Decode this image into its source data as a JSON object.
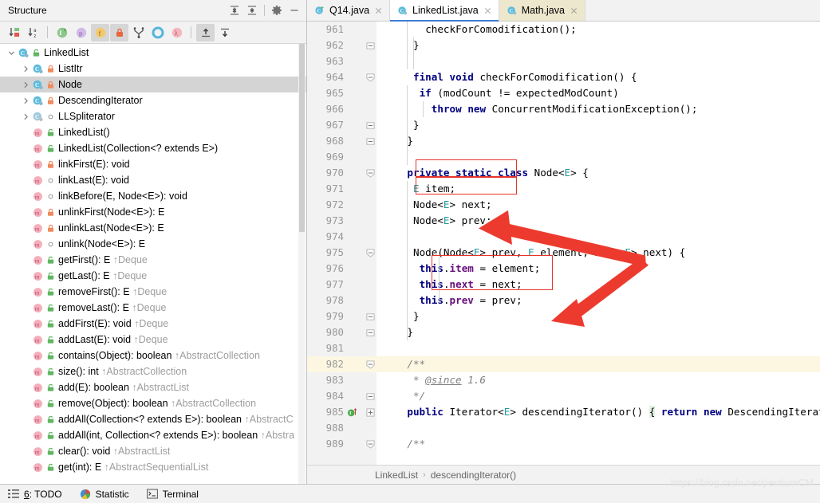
{
  "structure": {
    "title": "Structure",
    "header_buttons": [
      {
        "name": "expand-all-icon",
        "label": "Expand All"
      },
      {
        "name": "collapse-all-icon",
        "label": "Collapse All"
      },
      {
        "name": "gear-icon",
        "label": "Settings"
      },
      {
        "name": "hide-icon",
        "label": "Hide"
      }
    ],
    "toolbar_buttons": [
      {
        "name": "sort-by-visibility-icon",
        "label": "Sort by Visibility",
        "active": false
      },
      {
        "name": "sort-alphabetically-icon",
        "label": "Sort Alphabetically",
        "active": false
      },
      {
        "name": "show-inherited-icon",
        "label": "Show Inherited",
        "active": false
      },
      {
        "name": "show-properties-icon",
        "label": "Show Properties",
        "active": false
      },
      {
        "name": "show-fields-icon",
        "label": "Show Fields",
        "active": true
      },
      {
        "name": "show-non-public-icon",
        "label": "Show Non-Public",
        "active": true
      },
      {
        "name": "show-anonymous-classes-icon",
        "label": "Show Anonymous Classes",
        "active": false
      },
      {
        "name": "group-by-interface-icon",
        "label": "Group Methods by Defining Type",
        "active": false
      },
      {
        "name": "show-lambdas-icon",
        "label": "Show Lambdas",
        "active": false
      },
      {
        "name": "autoscroll-to-source-icon",
        "label": "Autoscroll to Source",
        "active": true
      },
      {
        "name": "autoscroll-from-source-icon",
        "label": "Autoscroll from Source",
        "active": false
      }
    ],
    "tree": [
      {
        "label": "LinkedList",
        "depth": 0,
        "twisty": "expanded",
        "icon": "class-icon",
        "vis": "protected-green",
        "selected": false
      },
      {
        "label": "ListItr",
        "depth": 1,
        "twisty": "collapsed",
        "icon": "class-icon",
        "vis": "private-orange",
        "selected": false
      },
      {
        "label": "Node",
        "depth": 1,
        "twisty": "collapsed",
        "icon": "class-icon",
        "vis": "private-orange",
        "selected": true
      },
      {
        "label": "DescendingIterator",
        "depth": 1,
        "twisty": "collapsed",
        "icon": "class-icon",
        "vis": "private-orange",
        "selected": false
      },
      {
        "label": "LLSpliterator",
        "depth": 1,
        "twisty": "collapsed",
        "icon": "class-excluded-icon",
        "vis": "package-local",
        "selected": false
      },
      {
        "label": "LinkedList()",
        "depth": 1,
        "twisty": "none",
        "icon": "method-icon",
        "vis": "protected-green",
        "selected": false
      },
      {
        "label": "LinkedList(Collection<? extends E>)",
        "depth": 1,
        "twisty": "none",
        "icon": "method-icon",
        "vis": "protected-green",
        "selected": false
      },
      {
        "label": "linkFirst(E): void",
        "depth": 1,
        "twisty": "none",
        "icon": "method-icon",
        "vis": "private-orange",
        "selected": false
      },
      {
        "label": "linkLast(E): void",
        "depth": 1,
        "twisty": "none",
        "icon": "method-icon",
        "vis": "package-local",
        "selected": false
      },
      {
        "label": "linkBefore(E, Node<E>): void",
        "depth": 1,
        "twisty": "none",
        "icon": "method-icon",
        "vis": "package-local",
        "selected": false
      },
      {
        "label": "unlinkFirst(Node<E>): E",
        "depth": 1,
        "twisty": "none",
        "icon": "method-icon",
        "vis": "private-orange",
        "selected": false
      },
      {
        "label": "unlinkLast(Node<E>): E",
        "depth": 1,
        "twisty": "none",
        "icon": "method-icon",
        "vis": "private-orange",
        "selected": false
      },
      {
        "label": "unlink(Node<E>): E",
        "depth": 1,
        "twisty": "none",
        "icon": "method-icon",
        "vis": "package-local",
        "selected": false
      },
      {
        "label": "getFirst(): E",
        "inherited": "↑Deque",
        "depth": 1,
        "twisty": "none",
        "icon": "method-icon",
        "vis": "protected-green",
        "selected": false
      },
      {
        "label": "getLast(): E",
        "inherited": "↑Deque",
        "depth": 1,
        "twisty": "none",
        "icon": "method-icon",
        "vis": "protected-green",
        "selected": false
      },
      {
        "label": "removeFirst(): E",
        "inherited": "↑Deque",
        "depth": 1,
        "twisty": "none",
        "icon": "method-icon",
        "vis": "protected-green",
        "selected": false
      },
      {
        "label": "removeLast(): E",
        "inherited": "↑Deque",
        "depth": 1,
        "twisty": "none",
        "icon": "method-icon",
        "vis": "protected-green",
        "selected": false
      },
      {
        "label": "addFirst(E): void",
        "inherited": "↑Deque",
        "depth": 1,
        "twisty": "none",
        "icon": "method-icon",
        "vis": "protected-green",
        "selected": false
      },
      {
        "label": "addLast(E): void",
        "inherited": "↑Deque",
        "depth": 1,
        "twisty": "none",
        "icon": "method-icon",
        "vis": "protected-green",
        "selected": false
      },
      {
        "label": "contains(Object): boolean",
        "inherited": "↑AbstractCollection",
        "depth": 1,
        "twisty": "none",
        "icon": "method-icon",
        "vis": "protected-green",
        "selected": false
      },
      {
        "label": "size(): int",
        "inherited": "↑AbstractCollection",
        "depth": 1,
        "twisty": "none",
        "icon": "method-icon",
        "vis": "protected-green",
        "selected": false
      },
      {
        "label": "add(E): boolean",
        "inherited": "↑AbstractList",
        "depth": 1,
        "twisty": "none",
        "icon": "method-icon",
        "vis": "protected-green",
        "selected": false
      },
      {
        "label": "remove(Object): boolean",
        "inherited": "↑AbstractCollection",
        "depth": 1,
        "twisty": "none",
        "icon": "method-icon",
        "vis": "protected-green",
        "selected": false
      },
      {
        "label": "addAll(Collection<? extends E>): boolean",
        "inherited": "↑AbstractC",
        "depth": 1,
        "twisty": "none",
        "icon": "method-icon",
        "vis": "protected-green",
        "selected": false
      },
      {
        "label": "addAll(int, Collection<? extends E>): boolean",
        "inherited": "↑Abstra",
        "depth": 1,
        "twisty": "none",
        "icon": "method-icon",
        "vis": "protected-green",
        "selected": false
      },
      {
        "label": "clear(): void",
        "inherited": "↑AbstractList",
        "depth": 1,
        "twisty": "none",
        "icon": "method-icon",
        "vis": "protected-green",
        "selected": false
      },
      {
        "label": "get(int): E",
        "inherited": "↑AbstractSequentialList",
        "depth": 1,
        "twisty": "none",
        "icon": "method-icon",
        "vis": "protected-green",
        "selected": false
      }
    ]
  },
  "editor": {
    "tabs": [
      {
        "label": "Q14.java",
        "icon": "java-run-icon",
        "state": "inactive"
      },
      {
        "label": "LinkedList.java",
        "icon": "java-readonly-icon",
        "state": "selected"
      },
      {
        "label": "Math.java",
        "icon": "java-readonly-icon",
        "state": "highlight"
      }
    ],
    "lines": [
      {
        "no": "961",
        "fold": "",
        "gicon": "",
        "indent": 7,
        "tokens": [
          [
            "dflt",
            "checkForComodification();"
          ]
        ]
      },
      {
        "no": "962",
        "fold": "end",
        "gicon": "",
        "indent": 5,
        "tokens": [
          [
            "dflt",
            "}"
          ]
        ]
      },
      {
        "no": "963",
        "fold": "",
        "gicon": "",
        "indent": 0,
        "tokens": []
      },
      {
        "no": "964",
        "fold": "start",
        "gicon": "",
        "indent": 5,
        "tokens": [
          [
            "kw",
            "final"
          ],
          [
            "dflt",
            " "
          ],
          [
            "kw",
            "void"
          ],
          [
            "dflt",
            " checkForComodification() {"
          ]
        ]
      },
      {
        "no": "965",
        "fold": "",
        "gicon": "",
        "indent": 6,
        "tokens": [
          [
            "kw",
            "if"
          ],
          [
            "dflt",
            " (modCount != expectedModCount)"
          ]
        ]
      },
      {
        "no": "966",
        "fold": "",
        "gicon": "",
        "indent": 8,
        "tokens": [
          [
            "kw",
            "throw"
          ],
          [
            "dflt",
            " "
          ],
          [
            "kw",
            "new"
          ],
          [
            "dflt",
            " ConcurrentModificationException();"
          ]
        ]
      },
      {
        "no": "967",
        "fold": "end",
        "gicon": "",
        "indent": 5,
        "tokens": [
          [
            "dflt",
            "}"
          ]
        ]
      },
      {
        "no": "968",
        "fold": "end",
        "gicon": "",
        "indent": 4,
        "tokens": [
          [
            "dflt",
            "}"
          ]
        ]
      },
      {
        "no": "969",
        "fold": "",
        "gicon": "",
        "indent": 0,
        "tokens": []
      },
      {
        "no": "970",
        "fold": "start",
        "gicon": "",
        "indent": 4,
        "tokens": [
          [
            "kw",
            "private static class"
          ],
          [
            "dflt",
            " Node<"
          ],
          [
            "ty",
            "E"
          ],
          [
            "dflt",
            "> {"
          ]
        ]
      },
      {
        "no": "971",
        "fold": "",
        "gicon": "",
        "indent": 5,
        "tokens": [
          [
            "ty",
            "E"
          ],
          [
            "dflt",
            " item;"
          ]
        ]
      },
      {
        "no": "972",
        "fold": "",
        "gicon": "",
        "indent": 5,
        "tokens": [
          [
            "dflt",
            "Node<"
          ],
          [
            "ty",
            "E"
          ],
          [
            "dflt",
            "> next;"
          ]
        ]
      },
      {
        "no": "973",
        "fold": "",
        "gicon": "",
        "indent": 5,
        "tokens": [
          [
            "dflt",
            "Node<"
          ],
          [
            "ty",
            "E"
          ],
          [
            "dflt",
            "> prev;"
          ]
        ]
      },
      {
        "no": "974",
        "fold": "",
        "gicon": "",
        "indent": 0,
        "tokens": []
      },
      {
        "no": "975",
        "fold": "start",
        "gicon": "",
        "indent": 5,
        "tokens": [
          [
            "dflt",
            "Node(Node<"
          ],
          [
            "ty",
            "E"
          ],
          [
            "dflt",
            "> prev, "
          ],
          [
            "ty",
            "E"
          ],
          [
            "dflt",
            " element, Node<"
          ],
          [
            "ty",
            "E"
          ],
          [
            "dflt",
            "> next) {"
          ]
        ]
      },
      {
        "no": "976",
        "fold": "",
        "gicon": "",
        "indent": 6,
        "tokens": [
          [
            "kw",
            "this"
          ],
          [
            "dflt",
            "."
          ],
          [
            "fld",
            "item"
          ],
          [
            "dflt",
            " = element;"
          ]
        ]
      },
      {
        "no": "977",
        "fold": "",
        "gicon": "",
        "indent": 6,
        "tokens": [
          [
            "kw",
            "this"
          ],
          [
            "dflt",
            "."
          ],
          [
            "fld",
            "next"
          ],
          [
            "dflt",
            " = next;"
          ]
        ]
      },
      {
        "no": "978",
        "fold": "",
        "gicon": "",
        "indent": 6,
        "tokens": [
          [
            "kw",
            "this"
          ],
          [
            "dflt",
            "."
          ],
          [
            "fld",
            "prev"
          ],
          [
            "dflt",
            " = prev;"
          ]
        ]
      },
      {
        "no": "979",
        "fold": "end",
        "gicon": "",
        "indent": 5,
        "tokens": [
          [
            "dflt",
            "}"
          ]
        ]
      },
      {
        "no": "980",
        "fold": "end",
        "gicon": "",
        "indent": 4,
        "tokens": [
          [
            "dflt",
            "}"
          ]
        ]
      },
      {
        "no": "981",
        "fold": "",
        "gicon": "",
        "indent": 0,
        "tokens": []
      },
      {
        "no": "982",
        "fold": "start",
        "gicon": "",
        "indent": 4,
        "hl": true,
        "tokens": [
          [
            "cmt",
            "/**"
          ]
        ]
      },
      {
        "no": "983",
        "fold": "",
        "gicon": "",
        "indent": 4,
        "tokens": [
          [
            "cmt",
            " * "
          ],
          [
            "tag",
            "@since"
          ],
          [
            "cmt",
            " 1.6"
          ]
        ]
      },
      {
        "no": "984",
        "fold": "end",
        "gicon": "",
        "indent": 4,
        "tokens": [
          [
            "cmt",
            " */"
          ]
        ]
      },
      {
        "no": "985",
        "fold": "plus",
        "gicon": "implementing-method-icon",
        "indent": 4,
        "tokens": [
          [
            "kw",
            "public"
          ],
          [
            "dflt",
            " Iterator<"
          ],
          [
            "ty",
            "E"
          ],
          [
            "dflt",
            "> descendingIterator() "
          ],
          [
            "foldbrace",
            "{"
          ],
          [
            "dflt",
            " "
          ],
          [
            "kw",
            "return"
          ],
          [
            "dflt",
            " "
          ],
          [
            "kw",
            "new"
          ],
          [
            "dflt",
            " DescendingIterator();"
          ],
          [
            "foldbrace",
            " }"
          ]
        ]
      },
      {
        "no": "988",
        "fold": "",
        "gicon": "",
        "indent": 0,
        "tokens": []
      },
      {
        "no": "989",
        "fold": "start",
        "gicon": "",
        "indent": 4,
        "tokens": [
          [
            "cmt",
            "/**"
          ]
        ]
      }
    ],
    "annotations": {
      "boxes": [
        {
          "name": "highlight-box-next-field"
        },
        {
          "name": "highlight-box-prev-field"
        },
        {
          "name": "highlight-box-this-assignments"
        }
      ],
      "arrows": [
        {
          "name": "arrow-to-next-field"
        },
        {
          "name": "arrow-to-this-assignments"
        }
      ],
      "color": "#e8332a"
    },
    "breadcrumb": [
      "LinkedList",
      "descendingIterator()"
    ],
    "breadcrumb_separator": "›"
  },
  "statusbar": {
    "items": [
      {
        "name": "todo-button",
        "icon": "list-icon",
        "num": "6",
        "label": ": TODO"
      },
      {
        "name": "statistic-button",
        "icon": "statistic-icon",
        "num": "",
        "label": "Statistic"
      },
      {
        "name": "terminal-button",
        "icon": "terminal-icon",
        "num": "",
        "label": "Terminal"
      }
    ],
    "watermark": "https://blog.csdn.net/pentiumCM"
  }
}
